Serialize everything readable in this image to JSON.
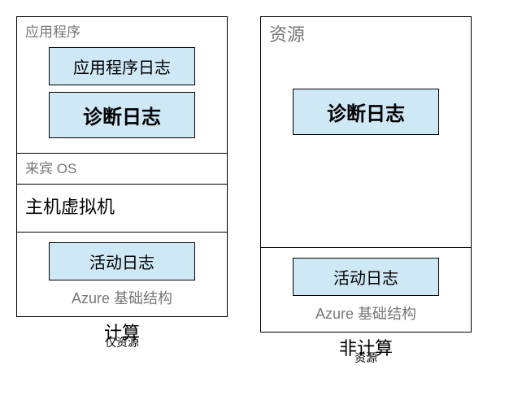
{
  "left": {
    "app_section_label": "应用程序",
    "app_log": "应用程序日志",
    "diag_log": "诊断日志",
    "guest_os_label": "来宾 OS",
    "host_vm": "主机虚拟机",
    "activity_log": "活动日志",
    "infra_label": "Azure 基础结构",
    "caption_main": "计算",
    "caption_sub": "仅资源"
  },
  "right": {
    "resource_label": "资源",
    "diag_log": "诊断日志",
    "activity_log": "活动日志",
    "infra_label": "Azure 基础结构",
    "caption_main": "非计算",
    "caption_sub": "资源"
  }
}
